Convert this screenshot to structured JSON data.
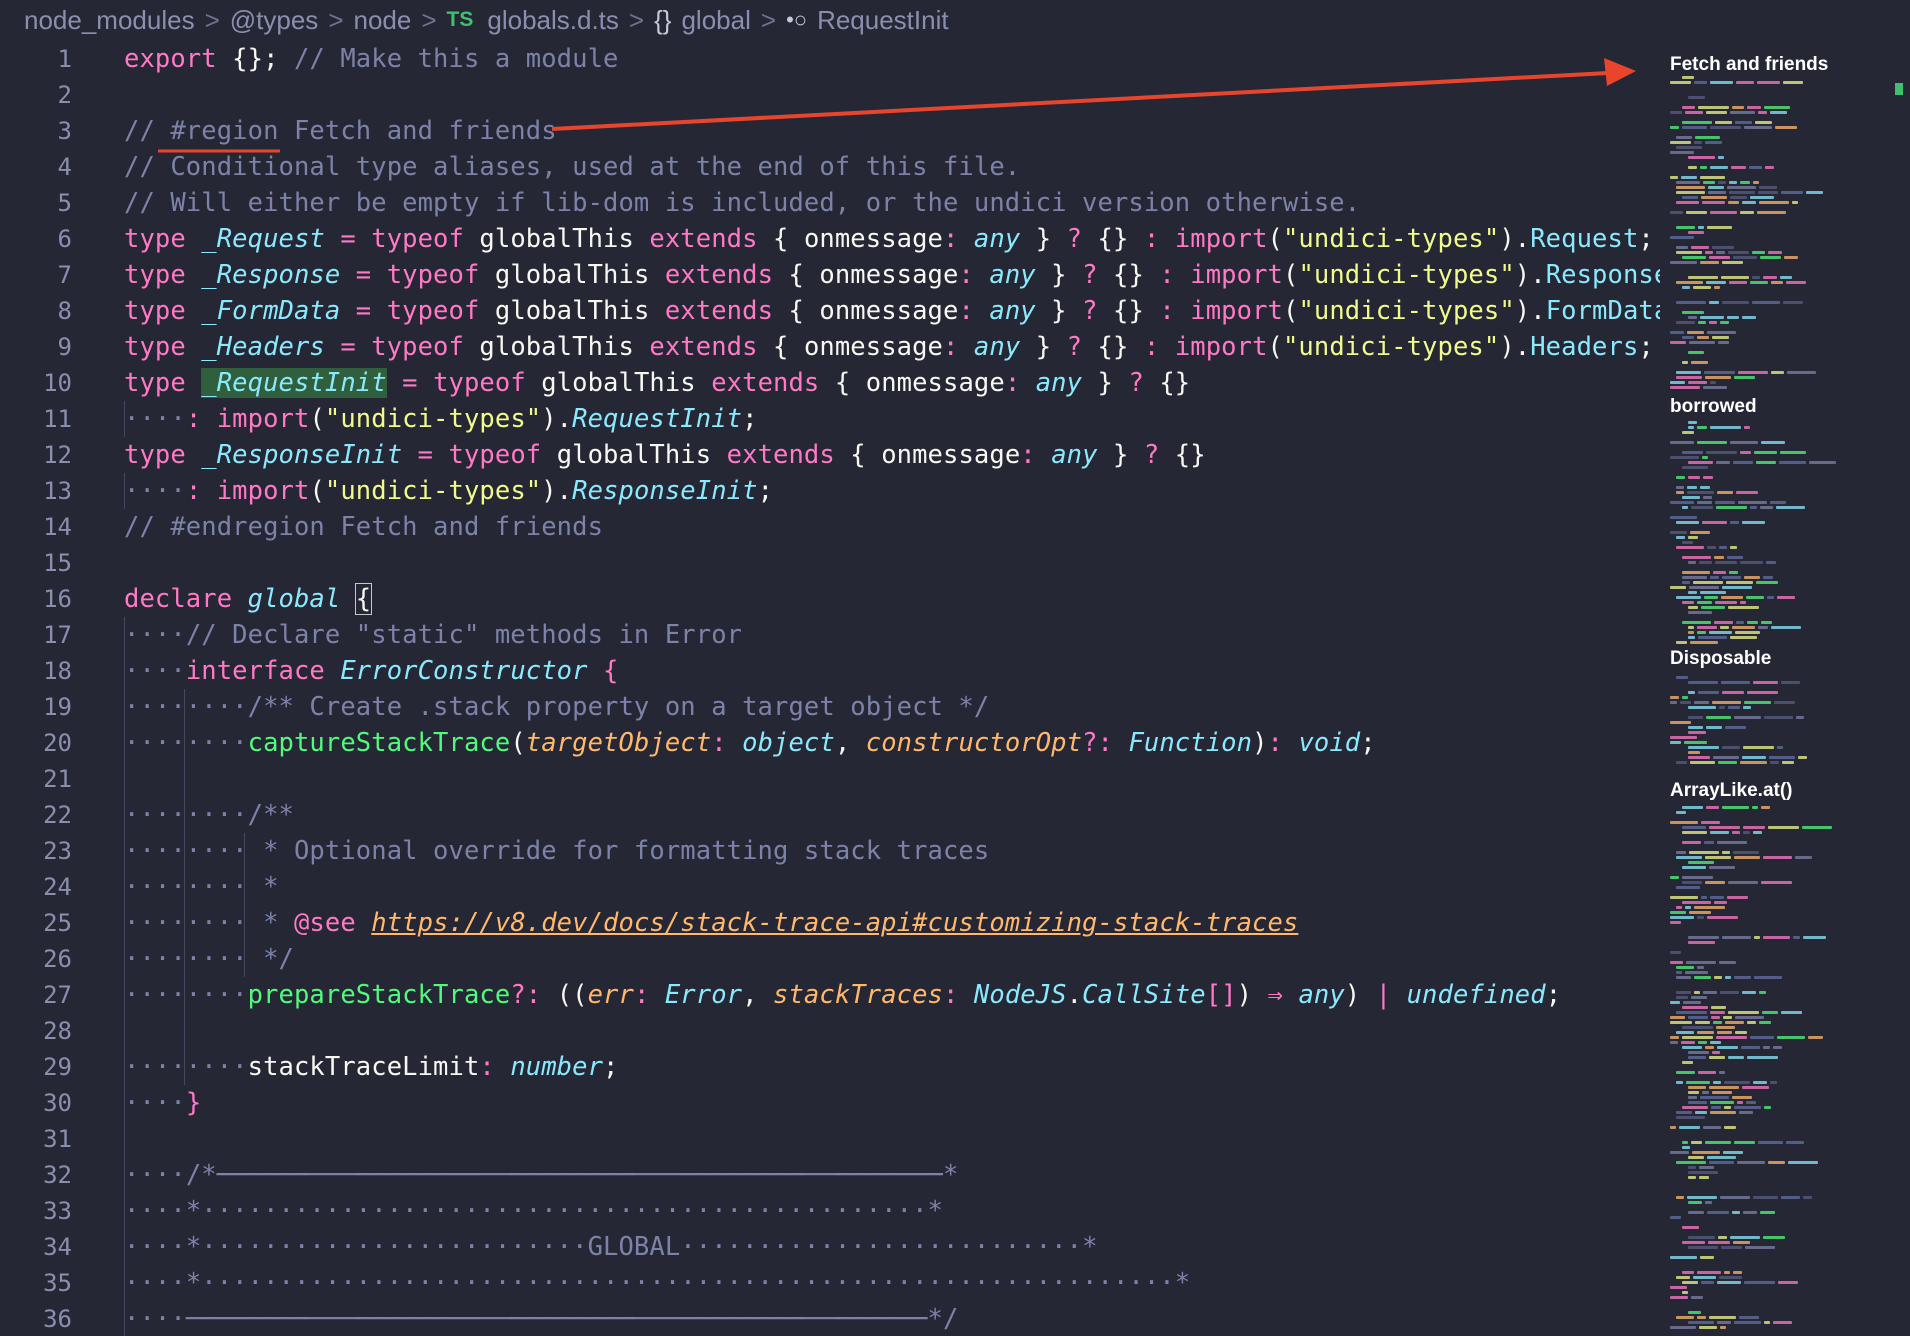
{
  "breadcrumb": {
    "parts": [
      "node_modules",
      "@types",
      "node"
    ],
    "ts_badge": "TS",
    "file": "globals.d.ts",
    "scope_icon": "{}",
    "scope": "global",
    "symbol_icon": "•○",
    "symbol": "RequestInit",
    "separator": ">"
  },
  "lines": [
    {
      "n": "1"
    },
    {
      "n": "2"
    },
    {
      "n": "3"
    },
    {
      "n": "4"
    },
    {
      "n": "5"
    },
    {
      "n": "6"
    },
    {
      "n": "7"
    },
    {
      "n": "8"
    },
    {
      "n": "9"
    },
    {
      "n": "10"
    },
    {
      "n": "11"
    },
    {
      "n": "12"
    },
    {
      "n": "13"
    },
    {
      "n": "14"
    },
    {
      "n": "15"
    },
    {
      "n": "16"
    },
    {
      "n": "17"
    },
    {
      "n": "18"
    },
    {
      "n": "19"
    },
    {
      "n": "20"
    },
    {
      "n": "21"
    },
    {
      "n": "22"
    },
    {
      "n": "23"
    },
    {
      "n": "24"
    },
    {
      "n": "25"
    },
    {
      "n": "26"
    },
    {
      "n": "27"
    },
    {
      "n": "28"
    },
    {
      "n": "29"
    },
    {
      "n": "30"
    },
    {
      "n": "31"
    },
    {
      "n": "32"
    },
    {
      "n": "33"
    },
    {
      "n": "34"
    },
    {
      "n": "35"
    },
    {
      "n": "36"
    }
  ],
  "code": {
    "l1": {
      "a": "export",
      "b": " {}; ",
      "c": "// Make this a module"
    },
    "l3": {
      "c": "// #region Fetch and friends"
    },
    "l4": {
      "c": "// Conditional type aliases, used at the end of this file."
    },
    "l5": {
      "c": "// Will either be empty if lib-dom is included, or the undici version otherwise."
    },
    "kw_type": "type",
    "kw_typeof": "typeof",
    "kw_extends": "extends",
    "kw_import": "import",
    "v_globalThis": "globalThis",
    "v_onmessage": "onmessage",
    "t_any": "any",
    "s_undici": "\"undici-types\"",
    "l6": {
      "name": "_Request",
      "prop": "Request"
    },
    "l7": {
      "name": "_Response",
      "prop": "Response"
    },
    "l8": {
      "name": "_FormData",
      "prop": "FormData"
    },
    "l9": {
      "name": "_Headers",
      "prop": "Headers"
    },
    "l10": {
      "name": "_RequestInit"
    },
    "l11": {
      "prop": "RequestInit"
    },
    "l12": {
      "name": "_ResponseInit"
    },
    "l13": {
      "prop": "ResponseInit"
    },
    "l14": {
      "c": "// #endregion Fetch and friends"
    },
    "l16": {
      "a": "declare",
      "b": "global",
      "brace": "{"
    },
    "l17": {
      "c": "// Declare \"static\" methods in Error"
    },
    "l18": {
      "a": "interface",
      "b": "ErrorConstructor",
      "brace": "{"
    },
    "l19": {
      "c": "/** Create .stack property on a target object */"
    },
    "l20": {
      "fn": "captureStackTrace",
      "p1": "targetObject",
      "t1": "object",
      "p2": "constructorOpt",
      "t2": "Function",
      "t3": "void"
    },
    "l22": {
      "c": "/**"
    },
    "l23": {
      "c": "* Optional override for formatting stack traces"
    },
    "l24": {
      "c": "*"
    },
    "l25": {
      "c": "* ",
      "tag": "@see",
      "link": "https://v8.dev/docs/stack-trace-api#customizing-stack-traces"
    },
    "l26": {
      "c": "*/"
    },
    "l27": {
      "fn": "prepareStackTrace",
      "p1": "err",
      "t1": "Error",
      "p2": "stackTraces",
      "ns": "NodeJS",
      "t2": "CallSite",
      "arrow": "⇒",
      "t3": "any",
      "t4": "undefined"
    },
    "l29": {
      "fn": "stackTraceLimit",
      "t1": "number"
    },
    "l30": {
      "brace": "}"
    },
    "l32": {
      "a": "/*",
      "rule": "───────────────────────────────────────────────",
      "b": "*"
    },
    "l33": {
      "a": "*",
      "b": "*"
    },
    "l34": {
      "a": "*",
      "mid": "GLOBAL",
      "b": "*"
    },
    "l35": {
      "a": "*",
      "b": "*"
    },
    "l36": {
      "rule": "────────────────────────────────────────────────",
      "b": "*/"
    }
  },
  "minimap": {
    "labels": [
      "Fetch and friends",
      "borrowed",
      "Disposable",
      "ArrayLike.at()"
    ]
  },
  "colors": {
    "background": "#262735",
    "keyword": "#ff79c6",
    "type": "#8be9fd",
    "string": "#f1fa8c",
    "param": "#ffb86c",
    "function": "#50fa7b",
    "comment": "#7d82a8",
    "annotation_arrow": "#e8452c"
  }
}
